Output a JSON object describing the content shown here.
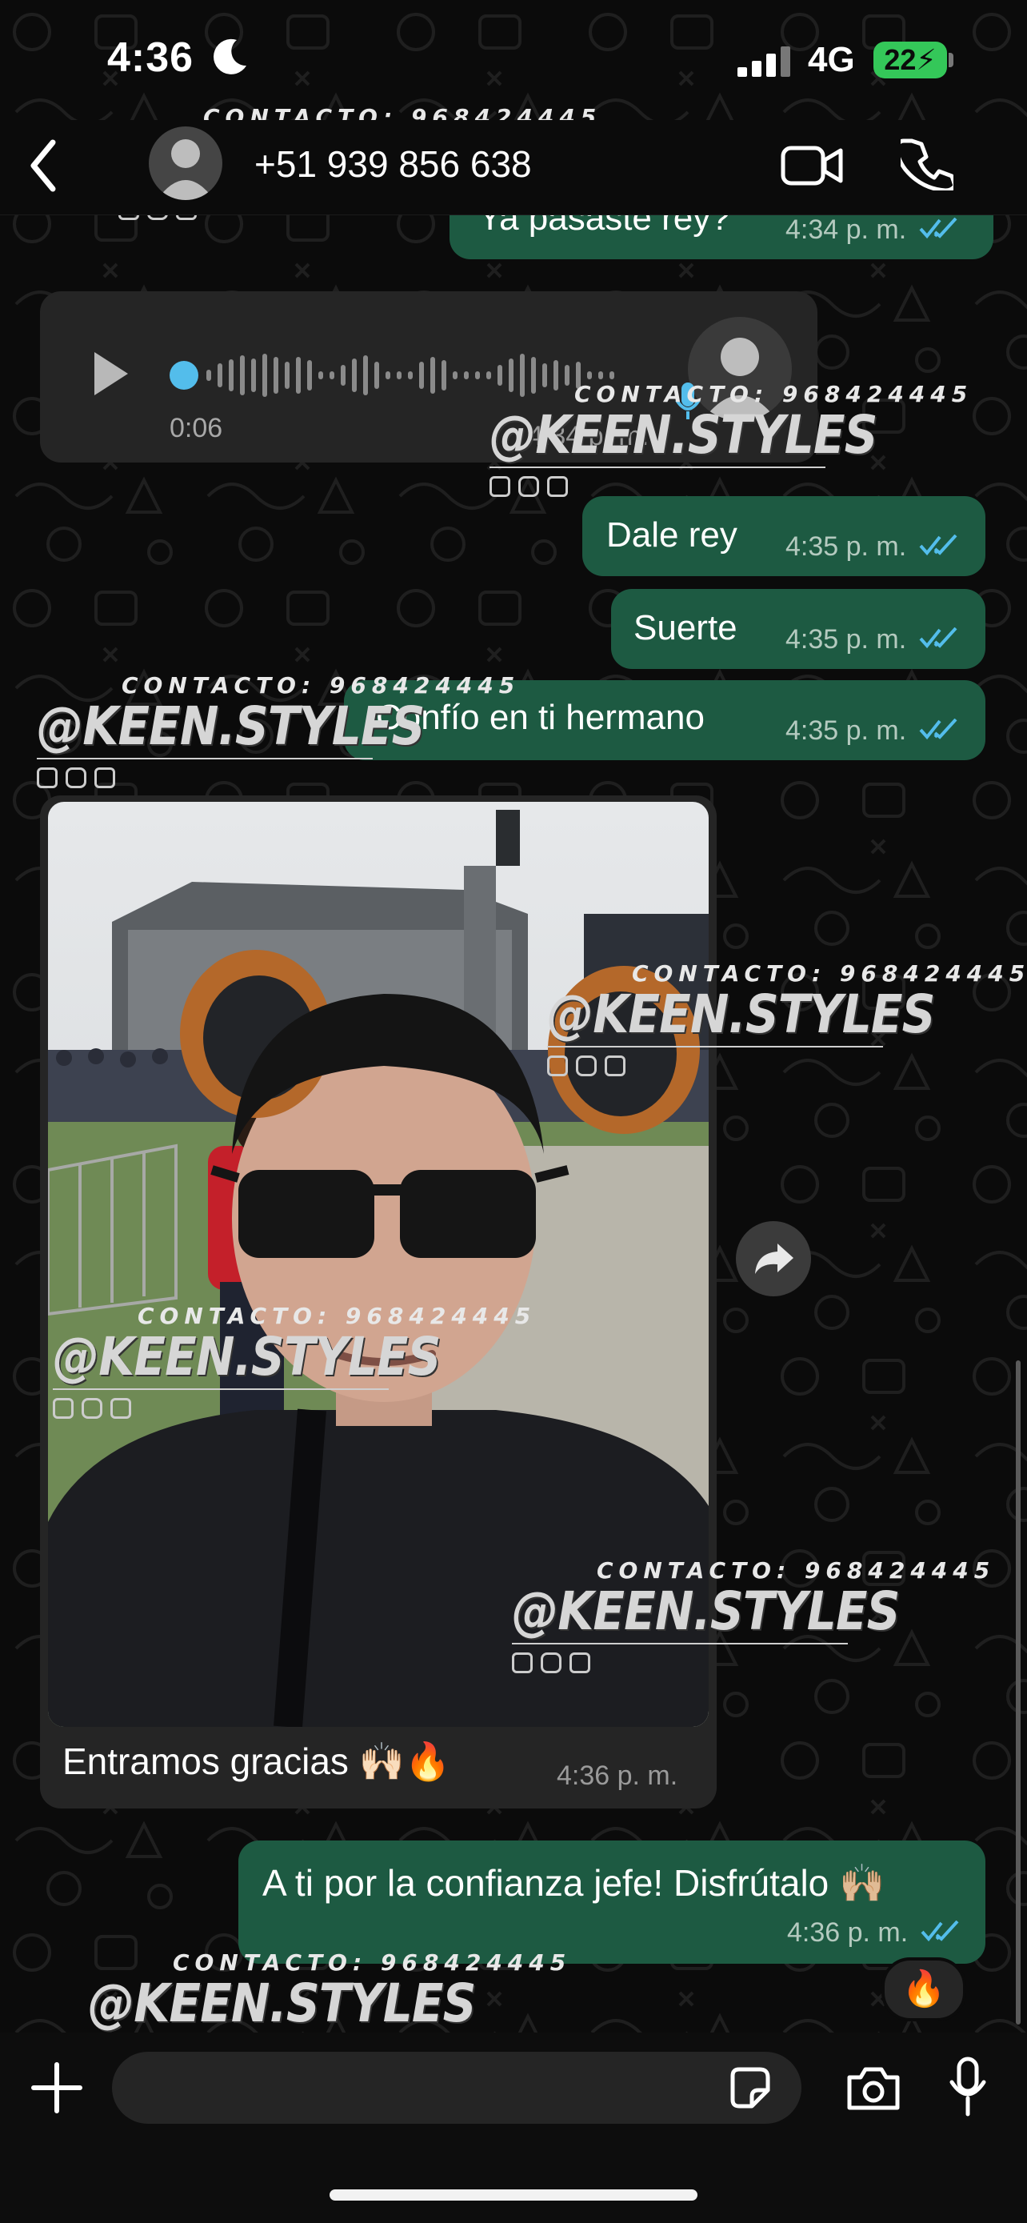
{
  "status_bar": {
    "time": "4:36",
    "network": "4G",
    "battery": "22"
  },
  "header": {
    "contact_name": "+51 939 856 638"
  },
  "messages": [
    {
      "type": "text",
      "direction": "out",
      "text": "Ya pasaste rey?",
      "time": "4:34 p. m."
    },
    {
      "type": "voice",
      "direction": "in",
      "duration": "0:06",
      "time": "4:34 p. m."
    },
    {
      "type": "text",
      "direction": "out",
      "text": "Dale rey",
      "time": "4:35 p. m."
    },
    {
      "type": "text",
      "direction": "out",
      "text": "Suerte",
      "time": "4:35 p. m."
    },
    {
      "type": "text",
      "direction": "out",
      "text": "Confío en ti hermano",
      "time": "4:35 p. m."
    },
    {
      "type": "image",
      "direction": "in",
      "caption": "Entramos gracias 🙌🏻🔥",
      "time": "4:36 p. m."
    },
    {
      "type": "text",
      "direction": "out",
      "text": "A ti por la confianza jefe! Disfrútalo 🙌🏼",
      "time": "4:36 p. m.",
      "reaction": "🔥"
    }
  ],
  "watermark": {
    "contact": "CONTACTO: 968424445",
    "handle": "@KEEN.STYLES"
  },
  "colors": {
    "outgoing_bubble": "#1d5a42",
    "incoming_bubble": "#252525",
    "read_ticks": "#53bdeb",
    "background": "#0b0b0b"
  }
}
